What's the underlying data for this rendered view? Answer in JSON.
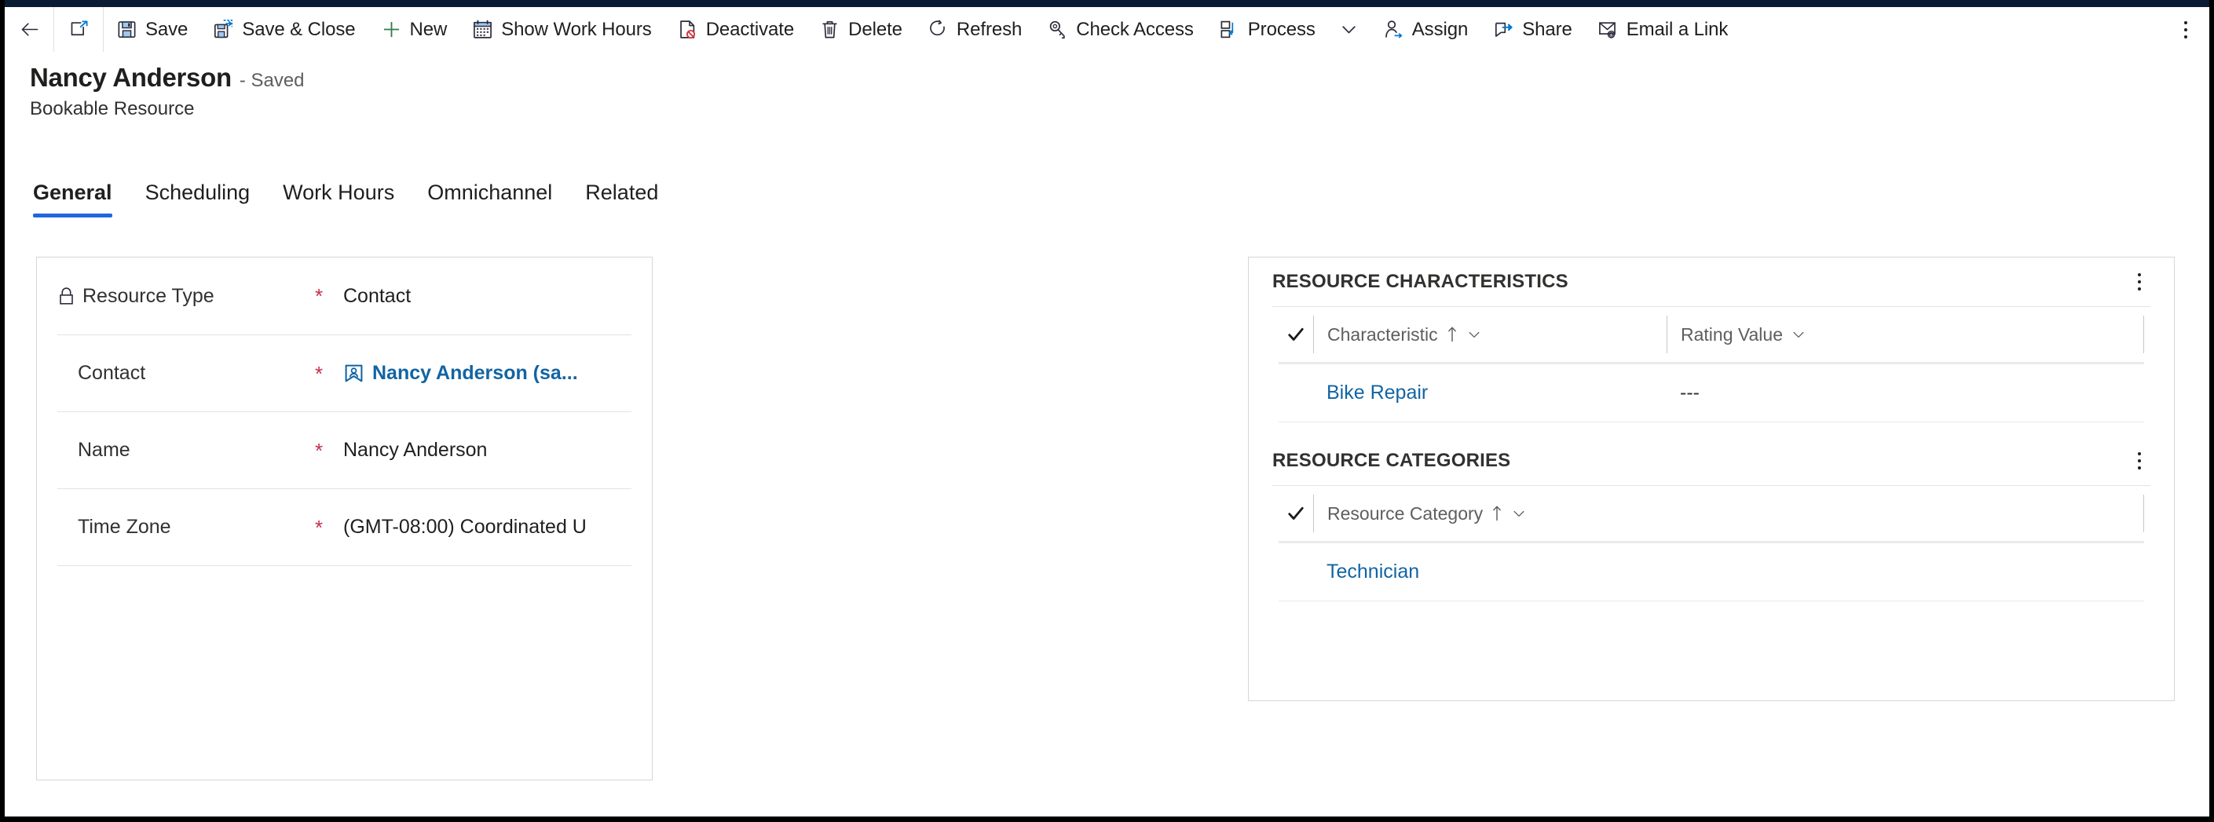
{
  "command_bar": {
    "back_icon": "back-arrow-icon",
    "popout_icon": "pop-out-icon",
    "buttons": [
      {
        "label": "Save",
        "icon": "save-floppy-icon"
      },
      {
        "label": "Save & Close",
        "icon": "save-and-close-icon"
      },
      {
        "label": "New",
        "icon": "plus-icon"
      },
      {
        "label": "Show Work Hours",
        "icon": "calendar-icon"
      },
      {
        "label": "Deactivate",
        "icon": "deactivate-document-icon"
      },
      {
        "label": "Delete",
        "icon": "trash-icon"
      },
      {
        "label": "Refresh",
        "icon": "refresh-icon"
      },
      {
        "label": "Check Access",
        "icon": "key-icon"
      },
      {
        "label": "Process",
        "icon": "process-flow-icon",
        "has_chevron": true
      },
      {
        "label": "Assign",
        "icon": "assign-person-icon"
      },
      {
        "label": "Share",
        "icon": "share-icon"
      },
      {
        "label": "Email a Link",
        "icon": "email-link-icon"
      }
    ],
    "overflow_icon": "more-vertical-icon"
  },
  "header": {
    "title": "Nancy Anderson",
    "status": "- Saved",
    "subtitle": "Bookable Resource"
  },
  "tabs": [
    {
      "label": "General",
      "active": true
    },
    {
      "label": "Scheduling",
      "active": false
    },
    {
      "label": "Work Hours",
      "active": false
    },
    {
      "label": "Omnichannel",
      "active": false
    },
    {
      "label": "Related",
      "active": false
    }
  ],
  "form": {
    "fields": [
      {
        "label": "Resource Type",
        "required": "*",
        "value": "Contact",
        "locked": true,
        "lock_icon": "lock-icon",
        "is_link": false
      },
      {
        "label": "Contact",
        "required": "*",
        "value": "Nancy Anderson (sa...",
        "locked": false,
        "is_link": true,
        "value_icon": "contact-card-icon"
      },
      {
        "label": "Name",
        "required": "*",
        "value": "Nancy Anderson",
        "locked": false,
        "is_link": false
      },
      {
        "label": "Time Zone",
        "required": "*",
        "value": "(GMT-08:00) Coordinated U",
        "locked": false,
        "is_link": false
      }
    ]
  },
  "side_panel": {
    "sections": [
      {
        "title": "RESOURCE CHARACTERISTICS",
        "more_icon": "more-vertical-icon",
        "select_all_icon": "checkmark-icon",
        "columns": [
          {
            "label": "Characteristic",
            "sort_icon": "sort-ascending-icon",
            "chevron_icon": "chevron-down-icon"
          },
          {
            "label": "Rating Value",
            "sort_icon": "",
            "chevron_icon": "chevron-down-icon"
          }
        ],
        "rows": [
          {
            "cells": [
              "Bike Repair",
              "---"
            ]
          }
        ]
      },
      {
        "title": "RESOURCE CATEGORIES",
        "more_icon": "more-vertical-icon",
        "select_all_icon": "checkmark-icon",
        "columns": [
          {
            "label": "Resource Category",
            "sort_icon": "sort-ascending-icon",
            "chevron_icon": "chevron-down-icon"
          }
        ],
        "rows": [
          {
            "cells": [
              "Technician"
            ]
          }
        ]
      }
    ]
  },
  "colors": {
    "accent": "#2266dd",
    "link": "#1264a3",
    "required": "#c4314b",
    "icon_blue": "#0078d4",
    "text": "#201f1e",
    "muted": "#605e5c",
    "topbar": "#0b1b33"
  }
}
